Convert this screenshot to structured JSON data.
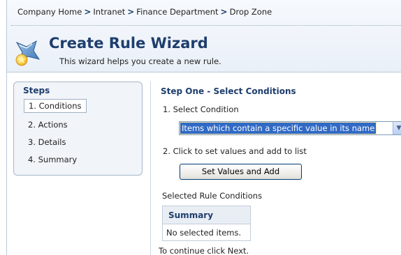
{
  "breadcrumb": {
    "items": [
      "Company Home",
      "Intranet",
      "Finance Department",
      "Drop Zone"
    ],
    "separator": ">"
  },
  "header": {
    "title": "Create Rule Wizard",
    "description": "This wizard helps you create a new rule.",
    "icon": "wizard-icon"
  },
  "steps": {
    "heading": "Steps",
    "items": [
      {
        "label": "1. Conditions",
        "active": true
      },
      {
        "label": "2. Actions",
        "active": false
      },
      {
        "label": "3. Details",
        "active": false
      },
      {
        "label": "4. Summary",
        "active": false
      }
    ]
  },
  "main": {
    "step_title": "Step One - Select Conditions",
    "select_condition_label": "1. Select Condition",
    "condition_select": {
      "selected": "Items which contain a specific value in its name"
    },
    "set_values_label": "2. Click to set values and add to list",
    "set_values_button": "Set Values and Add",
    "selected_conditions_label": "Selected Rule Conditions",
    "table": {
      "header": "Summary",
      "empty_text": "No selected items."
    },
    "continue_text": "To continue click Next."
  },
  "colors": {
    "title": "#1e3e6d",
    "selection": "#316ac5",
    "panel_border": "#a7b7ca"
  }
}
